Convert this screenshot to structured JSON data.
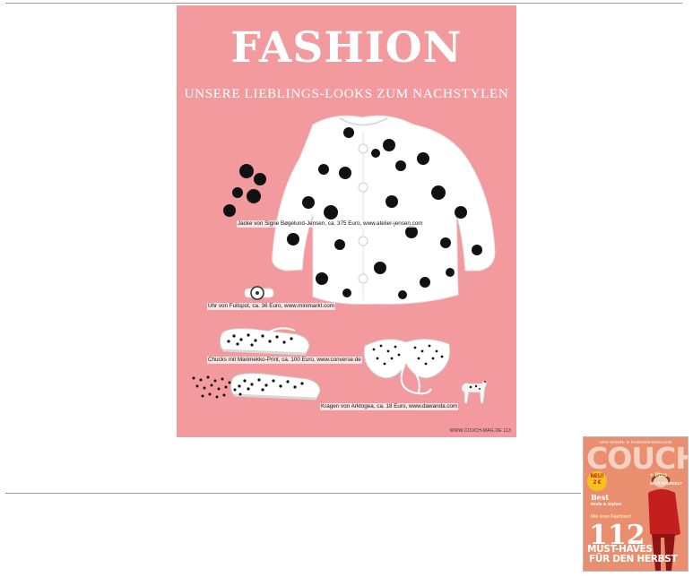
{
  "spread": {
    "title": "FASHION",
    "subtitle": "UNSERE LIEBLINGS-LOOKS ZUM NACHSTYLEN",
    "captions": {
      "jacket": "Jacke von Signe Bøgelund-Jensen, ca. 375 Euro, www.atelier-jensen.com",
      "watch": "Uhr von Fullspot, ca. 36 Euro, www.minimarkt.com",
      "shoes": "Chucks mit Marimekko-Print, ca. 100 Euro, www.converse.de",
      "collar": "Kragen von Arktogea, ca. 18 Euro, www.dawanda.com"
    },
    "folio": "WWW.COUCH-MAG.DE  113",
    "colors": {
      "background": "#f29a9e",
      "title": "#ffffff",
      "dots": "#111111",
      "garment": "#ffffff"
    }
  },
  "magazine_cover": {
    "tagline": "UNS WOHN- & FASHION-MAGAZIN",
    "logo": "COUCH",
    "badge_line1": "NEU!",
    "badge_line2": "2 €",
    "line_best": "Best",
    "line_plus": "+ Plus",
    "line_mode": "Mode & Styles!",
    "line_diy": "DO IT YOURSELF",
    "line_fashion": "We love Fashion!",
    "big_number": "112",
    "line_must": "MUST-HAVES",
    "line_fur": "FÜR DEN HERBST",
    "colors": {
      "background": "#e98f6f",
      "logo": "#f7d2c2",
      "coat": "#c41f1f"
    }
  }
}
